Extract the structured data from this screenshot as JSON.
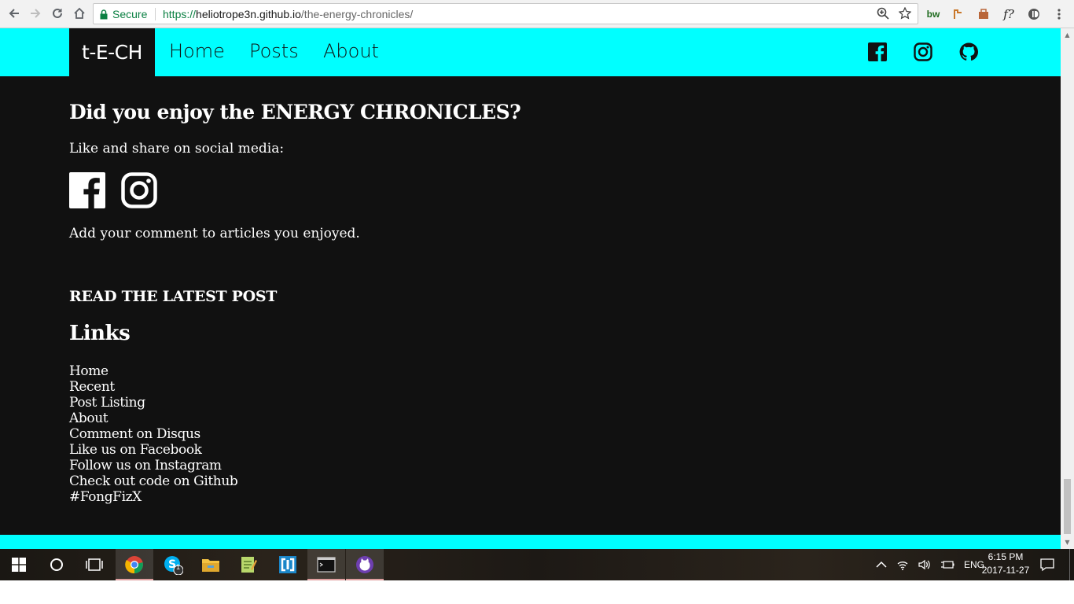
{
  "browser": {
    "secure_label": "Secure",
    "url_scheme": "https://",
    "url_host": "heliotrope3n.github.io",
    "url_path": "/the-energy-chronicles/",
    "extensions": [
      "bw",
      "f?"
    ]
  },
  "site": {
    "brand": "t-E-CH",
    "nav": [
      "Home",
      "Posts",
      "About"
    ],
    "header_social": [
      "facebook-icon",
      "instagram-icon",
      "github-icon"
    ],
    "accent_color": "#00ffff",
    "background_color": "#111111"
  },
  "main": {
    "enjoy_heading": "Did you enjoy the ENERGY CHRONICLES?",
    "like_share_text": "Like and share on social media:",
    "comment_text": "Add your comment to articles you enjoyed.",
    "latest_post_heading": "READ THE LATEST POST",
    "links_heading": "Links",
    "links": [
      "Home",
      "Recent",
      "Post Listing",
      "About",
      "Comment on Disqus",
      "Like us on Facebook",
      "Follow us on Instagram",
      "Check out code on Github",
      "#FongFizX"
    ]
  },
  "taskbar": {
    "apps": [
      "windows-start-icon",
      "cortana-icon",
      "task-view-icon",
      "chrome-icon",
      "skype-icon",
      "file-explorer-icon",
      "notepad-icon",
      "vmware-icon",
      "terminal-icon",
      "github-desktop-icon"
    ],
    "skype_badge": "1",
    "language": "ENG",
    "time": "6:15 PM",
    "date": "2017-11-27"
  }
}
